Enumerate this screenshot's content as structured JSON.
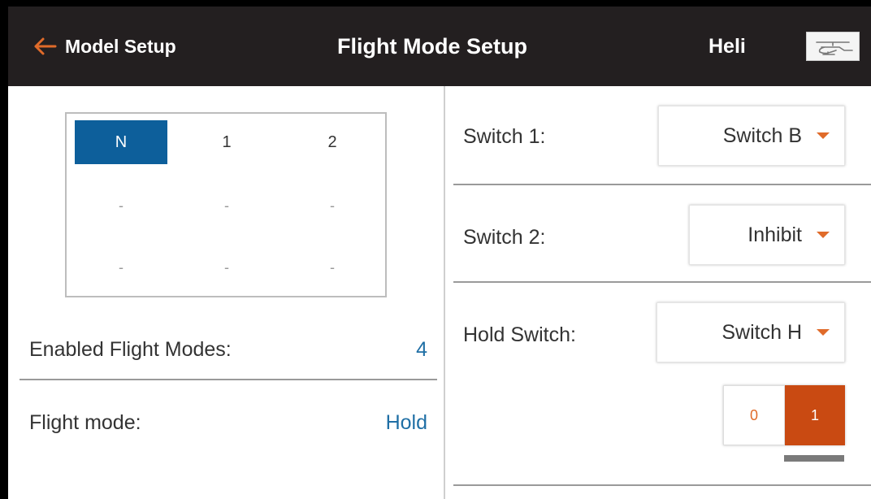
{
  "header": {
    "back_label": "Model Setup",
    "title": "Flight Mode Setup",
    "model_name": "Heli",
    "back_icon": "arrow-left-icon",
    "model_icon": "helicopter-icon",
    "accent_color": "#e06b2a"
  },
  "mode_grid": {
    "rows": [
      [
        "N",
        "1",
        "2"
      ],
      [
        "-",
        "-",
        "-"
      ],
      [
        "-",
        "-",
        "-"
      ]
    ],
    "active": "N"
  },
  "left": {
    "enabled_label": "Enabled Flight Modes:",
    "enabled_value": "4",
    "mode_label": "Flight mode:",
    "mode_value": "Hold"
  },
  "right": {
    "switch1_label": "Switch 1:",
    "switch1_value": "Switch B",
    "switch2_label": "Switch 2:",
    "switch2_value": "Inhibit",
    "hold_label": "Hold Switch:",
    "hold_value": "Switch H",
    "hold_positions": [
      "0",
      "1"
    ],
    "hold_active": "1"
  }
}
